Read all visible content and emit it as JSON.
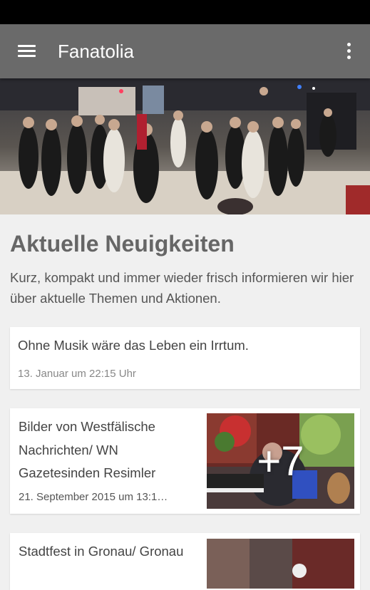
{
  "app": {
    "title": "Fanatolia",
    "menu_icon": "hamburger-menu-icon",
    "overflow_icon": "more-vert-icon",
    "header_color": "#6a6a6a"
  },
  "main": {
    "section_title": "Aktuelle Neuigkeiten",
    "section_description": "Kurz, kompakt und immer wieder frisch informieren wir hier über aktuelle Themen und Aktionen.",
    "news": [
      {
        "title": "Ohne Musik wäre das Leben ein Irrtum.",
        "date": "13. Januar um 22:15 Uhr"
      },
      {
        "title": "Bilder von Westfälische Nachrichten/ WN Gazetesinden Resimler",
        "date": "21. September 2015 um 13:1…",
        "more_images": "+7"
      },
      {
        "title": "Stadtfest in Gronau/ Gronau"
      }
    ]
  }
}
